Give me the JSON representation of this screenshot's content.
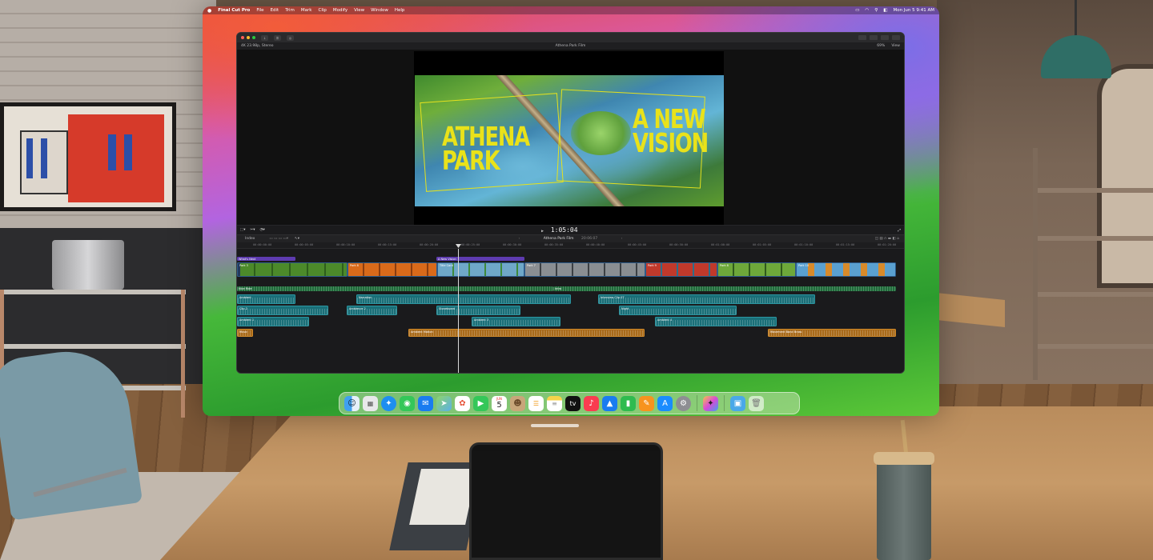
{
  "menubar": {
    "apple": "",
    "items": [
      "Final Cut Pro",
      "File",
      "Edit",
      "Trim",
      "Mark",
      "Clip",
      "Modify",
      "View",
      "Window",
      "Help"
    ],
    "clock": "Mon Jun 5 9:41 AM"
  },
  "fcp": {
    "format": "4K 23.98p, Stereo",
    "project_title": "Athena Park Film",
    "zoom": "69%",
    "view_menu": "View",
    "timecode": "1:05:04",
    "index_label": "Index",
    "timeline_project": "Athena Park Film",
    "timeline_duration": "20:06:07"
  },
  "title_card": {
    "left": "ATHENA\nPARK",
    "right": "A NEW\nVISION"
  },
  "ruler_ticks": [
    "00:00:00:00",
    "00:00:05:00",
    "00:00:10:00",
    "00:00:15:00",
    "00:00:20:00",
    "00:00:25:00",
    "00:00:30:00",
    "00:00:35:00",
    "00:00:40:00",
    "00:00:45:00",
    "00:00:50:00",
    "00:01:00:00",
    "00:01:05:00",
    "00:01:10:00",
    "00:01:15:00",
    "00:01:20:00"
  ],
  "timeline_clips": {
    "titles": [
      "What's Next",
      "A New Vision"
    ],
    "video": [
      "Park 3",
      "Park 6",
      "Park 8",
      "Title Card",
      "Park 7",
      "Park 9",
      "Park 8",
      "Park 10"
    ],
    "music": [
      "Nice Ride",
      "Intro"
    ],
    "audio_row1": [
      "Ambient",
      "Narration",
      "Interview Clip 07"
    ],
    "audio_row2": [
      "Clip 2",
      "Ambience 2",
      "Stoneboard",
      "Night"
    ],
    "audio_row3": [
      "Ambient 1",
      "Ambient 3",
      "Ambient 4"
    ],
    "orange": [
      "Music",
      "Ambient Motion",
      "Movement Band Brass"
    ]
  },
  "dock": {
    "apps": [
      "finder-icon",
      "launchpad-icon",
      "safari-icon",
      "messages-icon",
      "mail-icon",
      "maps-icon",
      "photos-icon",
      "facetime-icon",
      "calendar-icon",
      "contacts-icon",
      "reminders-icon",
      "notes-icon",
      "tv-icon",
      "music-icon",
      "keynote-icon",
      "numbers-icon",
      "pages-icon",
      "app-store-icon",
      "system-settings-icon",
      "final-cut-pro-icon",
      "downloads-folder-icon",
      "trash-icon"
    ],
    "calendar_day": "5",
    "calendar_month": "JUN"
  }
}
